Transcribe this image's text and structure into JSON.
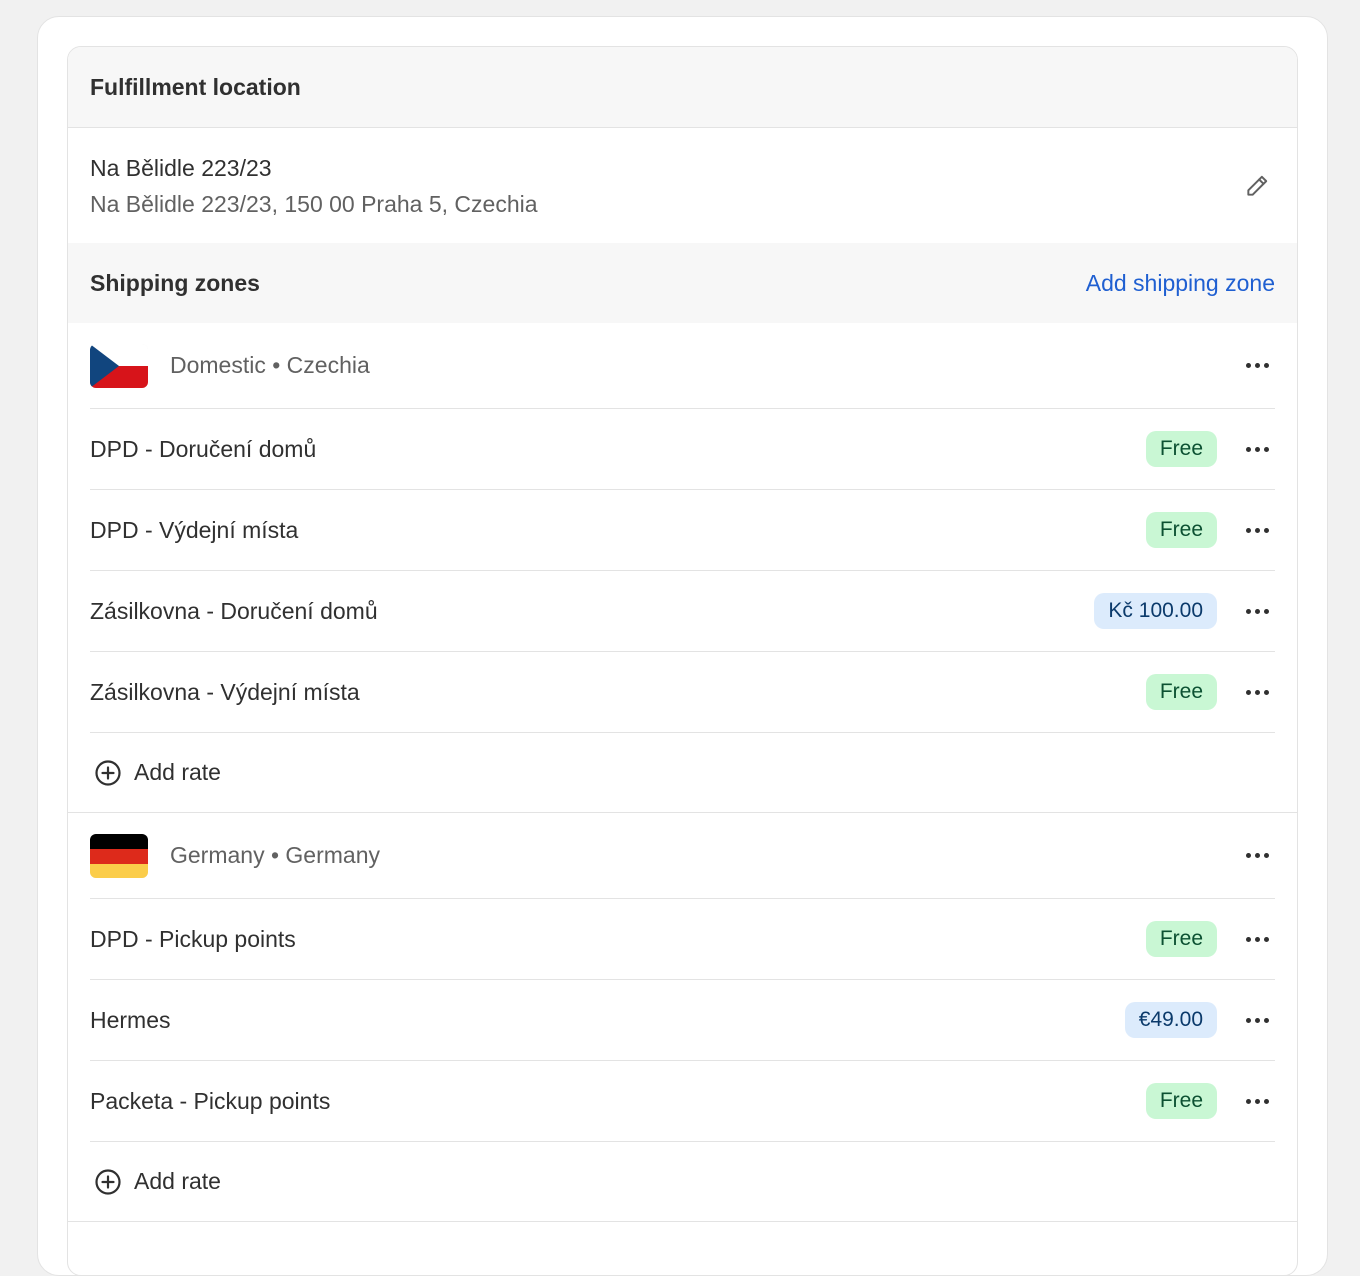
{
  "fulfillment": {
    "title": "Fulfillment location",
    "name": "Na Bělidle 223/23",
    "address": "Na Bělidle 223/23, 150 00 Praha 5, Czechia"
  },
  "shipping_zones": {
    "title": "Shipping zones",
    "add_zone_label": "Add shipping zone",
    "zones": [
      {
        "label": "Domestic • Czechia",
        "flag": "czechia-flag",
        "rates": [
          {
            "name": "DPD - Doručení domů",
            "price": "Free",
            "kind": "free"
          },
          {
            "name": "DPD - Výdejní místa",
            "price": "Free",
            "kind": "free"
          },
          {
            "name": "Zásilkovna - Doručení domů",
            "price": "Kč 100.00",
            "kind": "paid"
          },
          {
            "name": "Zásilkovna - Výdejní místa",
            "price": "Free",
            "kind": "free"
          }
        ],
        "add_rate_label": "Add rate"
      },
      {
        "label": "Germany • Germany",
        "flag": "germany-flag",
        "rates": [
          {
            "name": "DPD - Pickup points",
            "price": "Free",
            "kind": "free"
          },
          {
            "name": "Hermes",
            "price": "€49.00",
            "kind": "paid"
          },
          {
            "name": "Packeta - Pickup points",
            "price": "Free",
            "kind": "free"
          }
        ],
        "add_rate_label": "Add rate"
      }
    ]
  },
  "colors": {
    "free_badge_bg": "#c9f7d4",
    "paid_badge_bg": "#dcebfc",
    "link": "#1f5fd1"
  }
}
